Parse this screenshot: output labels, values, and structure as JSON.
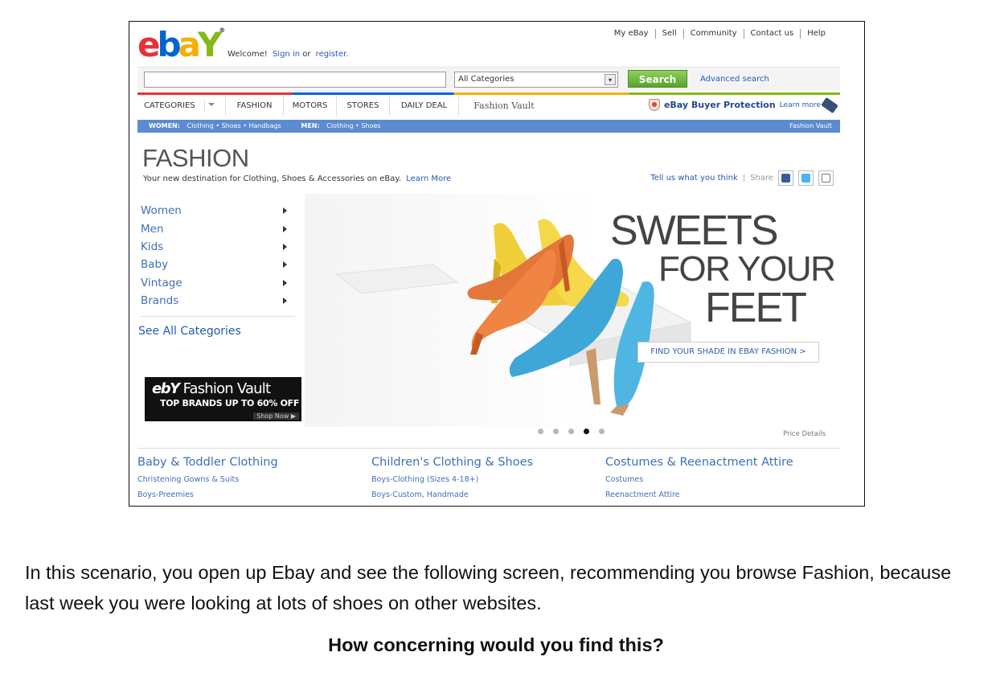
{
  "header": {
    "logo_letters": [
      "e",
      "b",
      "a",
      "Y"
    ],
    "logo_registered": "®",
    "welcome_prefix": "Welcome!",
    "sign_in": "Sign in",
    "or": "or",
    "register": "register.",
    "top_links": [
      "My eBay",
      "Sell",
      "Community",
      "Contact us",
      "Help"
    ]
  },
  "search": {
    "input_value": "",
    "category_selected": "All Categories",
    "search_button": "Search",
    "advanced_search": "Advanced search"
  },
  "tabs": {
    "items": [
      "CATEGORIES",
      "FASHION",
      "MOTORS",
      "STORES",
      "DAILY DEAL",
      "Fashion Vault"
    ],
    "buyer_protection": "eBay Buyer Protection",
    "learn_more": "Learn more"
  },
  "subnav": {
    "women_label": "WOMEN:",
    "women_links": "Clothing • Shoes • Handbags",
    "men_label": "MEN:",
    "men_links": "Clothing • Shoes",
    "fashion_vault": "Fashion Vault"
  },
  "fashion": {
    "title": "FASHION",
    "subtitle": "Your new destination for Clothing, Shoes & Accessories on eBay.",
    "learn_more": "Learn More",
    "tell_us": "Tell us what you think",
    "share": "Share"
  },
  "sidenav": {
    "items": [
      "Women",
      "Men",
      "Kids",
      "Baby",
      "Vintage",
      "Brands"
    ],
    "see_all": "See All Categories"
  },
  "vault_banner": {
    "title": "Fashion Vault",
    "subtitle": "TOP BRANDS UP TO 60% OFF",
    "shop_now": "Shop Now ▶"
  },
  "hero": {
    "line1": "SWEETS",
    "line2": "FOR YOUR",
    "line3": "FEET",
    "cta": "FIND YOUR SHADE IN EBAY FASHION >",
    "price_details": "Price Details",
    "slide_count": 5,
    "active_slide": 4
  },
  "columns": [
    {
      "heading": "Baby & Toddler Clothing",
      "links": [
        "Christening Gowns & Suits",
        "Boys-Preemies"
      ]
    },
    {
      "heading": "Children's Clothing & Shoes",
      "links": [
        "Boys-Clothing (Sizes 4-18+)",
        "Boys-Custom, Handmade"
      ]
    },
    {
      "heading": "Costumes & Reenactment Attire",
      "links": [
        "Costumes",
        "Reenactment Attire"
      ]
    }
  ],
  "caption": {
    "text": "In this scenario, you open up Ebay and see the following screen, recommending you browse Fashion, because last week you were looking at lots of shoes on other websites.",
    "question": "How concerning would you find this?"
  },
  "colors": {
    "logo_e": "#e53238",
    "logo_b": "#0064d2",
    "logo_a": "#f5af02",
    "logo_y": "#86b817",
    "link": "#2659b2",
    "subnav_bg": "#5b8bd0",
    "search_button": "#6cb33f"
  }
}
